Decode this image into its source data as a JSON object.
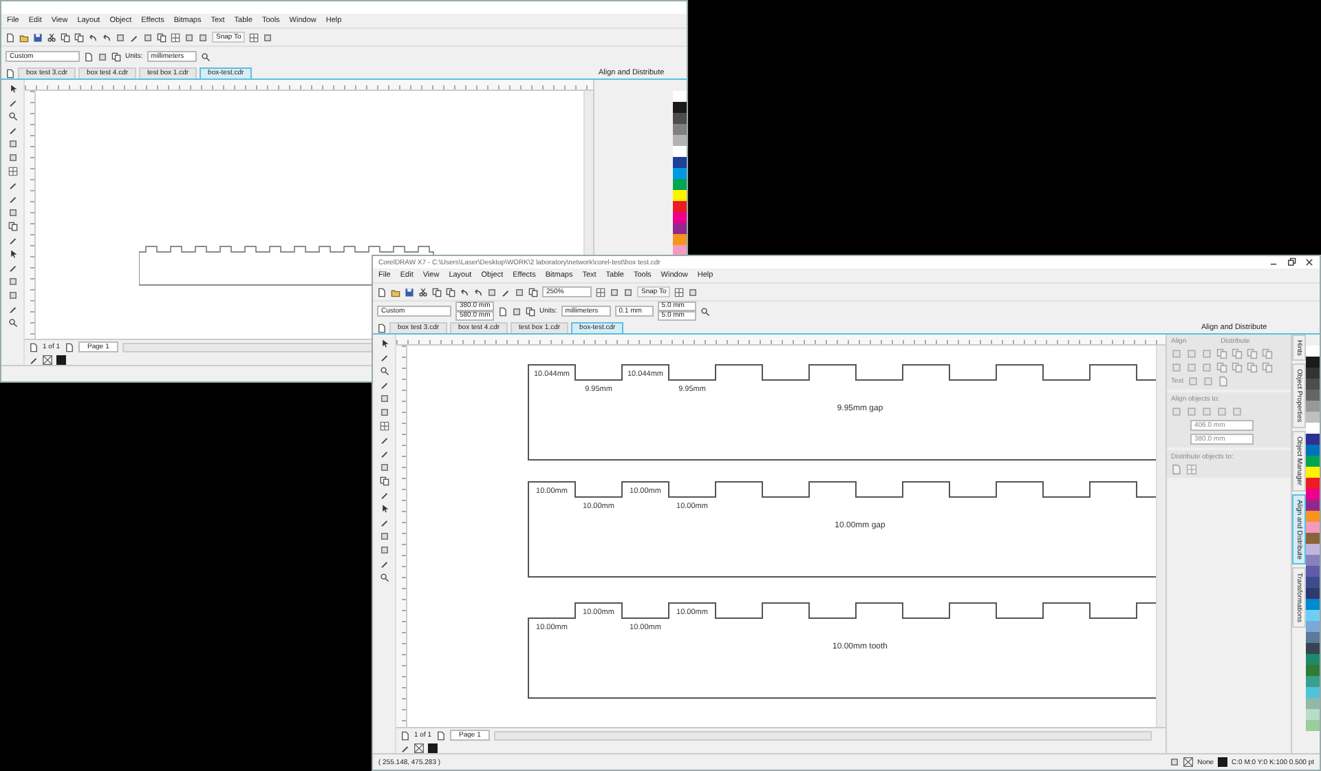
{
  "desktop": {
    "windows": [
      {
        "kind": "background",
        "menu": [
          "File",
          "Edit",
          "View",
          "Layout",
          "Object",
          "Effects",
          "Bitmaps",
          "Text",
          "Table",
          "Tools",
          "Window",
          "Help"
        ],
        "toolbar": {
          "snap": "Snap To"
        },
        "property_bar": {
          "page_size": "Custom",
          "units_label": "Units:",
          "units": "millimeters"
        },
        "tabs": [
          {
            "label": "box test 3.cdr",
            "selected": false
          },
          {
            "label": "box test 4.cdr",
            "selected": false
          },
          {
            "label": "test box 1.cdr",
            "selected": false
          },
          {
            "label": "box-test.cdr",
            "selected": true
          }
        ],
        "docker": {
          "title": "Align and Distribute"
        },
        "palette": [
          {
            "color": "#ffffff"
          },
          {
            "color": "#1a1a1a"
          },
          {
            "color": "#4d4d4d"
          },
          {
            "color": "#808080"
          },
          {
            "color": "#b3b3b3"
          },
          {
            "color": "#ffffff"
          },
          {
            "color": "#1f3f99"
          },
          {
            "color": "#0099e6"
          },
          {
            "color": "#00a650"
          },
          {
            "color": "#fff200"
          },
          {
            "color": "#ed1c24"
          },
          {
            "color": "#ec008c"
          },
          {
            "color": "#92278f"
          },
          {
            "color": "#f7941d"
          },
          {
            "color": "#f49ac1"
          }
        ],
        "page_nav": {
          "count": "1 of 1",
          "page": "Page 1"
        }
      },
      {
        "kind": "active",
        "title": "CorelDRAW X7 - C:\\Users\\Laser\\Desktop\\WORK\\2 laboratory\\network\\corel-test\\box test.cdr",
        "menu": [
          "File",
          "Edit",
          "View",
          "Layout",
          "Object",
          "Effects",
          "Bitmaps",
          "Text",
          "Table",
          "Tools",
          "Window",
          "Help"
        ],
        "toolbar": {
          "zoom": "250%",
          "snap": "Snap To"
        },
        "property_bar": {
          "page_size": "Custom",
          "width": "380.0 mm",
          "height": "580.0 mm",
          "units_label": "Units:",
          "units": "millimeters",
          "nudge": "0.1 mm",
          "dup_x": "5.0 mm",
          "dup_y": "5.0 mm"
        },
        "tabs": [
          {
            "label": "box test 3.cdr",
            "selected": false
          },
          {
            "label": "box test 4.cdr",
            "selected": false
          },
          {
            "label": "test box 1.cdr",
            "selected": false
          },
          {
            "label": "box-test.cdr",
            "selected": true
          }
        ],
        "docker": {
          "title": "Align and Distribute",
          "align": "Align",
          "distribute": "Distribute",
          "text_label": "Text",
          "align_to": "Align objects to:",
          "x": "406.0 mm",
          "y": "380.0 mm",
          "distribute_to": "Distribute objects to:"
        },
        "side_tabs": [
          {
            "label": "Hints",
            "selected": false
          },
          {
            "label": "Object Properties",
            "selected": false
          },
          {
            "label": "Object Manager",
            "selected": false
          },
          {
            "label": "Align and Distribute",
            "selected": true
          },
          {
            "label": "Transformations",
            "selected": false
          }
        ],
        "palette": [
          {
            "color": "#ffffff"
          },
          {
            "color": "#1a1a1a"
          },
          {
            "color": "#333333"
          },
          {
            "color": "#4d4d4d"
          },
          {
            "color": "#666666"
          },
          {
            "color": "#999999"
          },
          {
            "color": "#bfbfbf"
          },
          {
            "color": "#ffffff"
          },
          {
            "color": "#2e3192"
          },
          {
            "color": "#0072bc"
          },
          {
            "color": "#00a651"
          },
          {
            "color": "#fff200"
          },
          {
            "color": "#ed1c24"
          },
          {
            "color": "#ec008c"
          },
          {
            "color": "#92278f"
          },
          {
            "color": "#f7941d"
          },
          {
            "color": "#f49ac1"
          },
          {
            "color": "#8c6239"
          },
          {
            "color": "#c2b5d9"
          },
          {
            "color": "#8781bd"
          },
          {
            "color": "#605ca8"
          },
          {
            "color": "#3f4c8c"
          },
          {
            "color": "#2e3a6e"
          },
          {
            "color": "#0089d0"
          },
          {
            "color": "#6dcff6"
          },
          {
            "color": "#7da7d9"
          },
          {
            "color": "#5c7a99"
          },
          {
            "color": "#36454f"
          },
          {
            "color": "#1b8a6b"
          },
          {
            "color": "#2e7d32"
          },
          {
            "color": "#3a9e8f"
          },
          {
            "color": "#4fc3d9"
          },
          {
            "color": "#8fb9a8"
          },
          {
            "color": "#b8dcc4"
          },
          {
            "color": "#9ccc9c"
          }
        ],
        "drawing": {
          "panels": [
            {
              "kind": "tooth",
              "segments": [
                "10.044mm",
                "9.95mm",
                "10.044mm",
                "9.95mm"
              ],
              "caption": "9.95mm gap"
            },
            {
              "kind": "tooth",
              "segments": [
                "10.00mm",
                "10.00mm",
                "10.00mm",
                "10.00mm"
              ],
              "caption": "10.00mm gap"
            },
            {
              "kind": "gap",
              "segments": [
                "10.00mm",
                "10.00mm",
                "10.00mm",
                "10.00mm"
              ],
              "caption": "10.00mm tooth"
            }
          ]
        },
        "page_nav": {
          "count": "1 of 1",
          "page": "Page 1"
        },
        "status": {
          "coordinates": "( 255.148, 475.283 )",
          "fill": "None",
          "outline": "C:0 M:0 Y:0 K:100  0.500 pt"
        }
      }
    ]
  }
}
